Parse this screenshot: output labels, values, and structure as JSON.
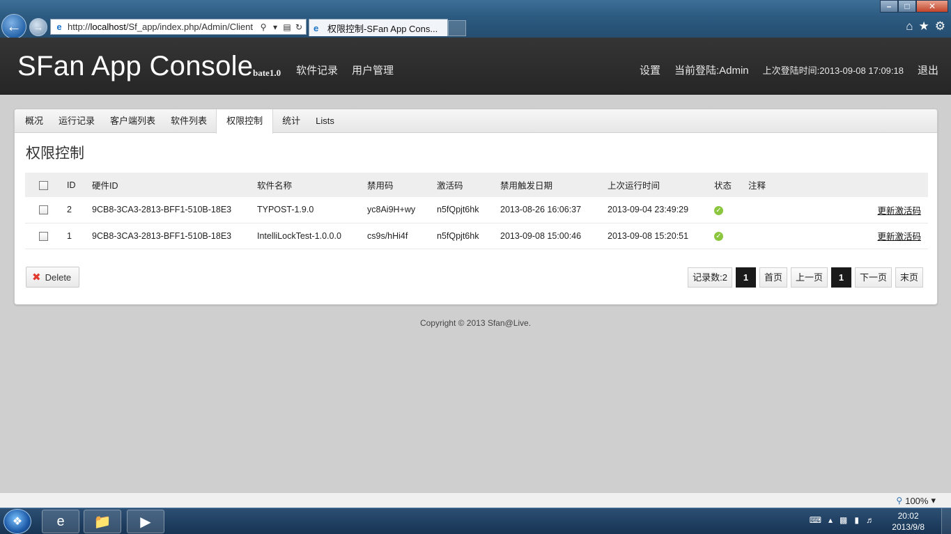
{
  "browser": {
    "url_prefix": "http://",
    "url_host": "localhost",
    "url_path": "/Sf_app/index.php/Admin/Client",
    "tab_title": "权限控制-SFan App Cons...",
    "zoom": "100%"
  },
  "header": {
    "brand": "SFan App Console",
    "version": "bate1.0",
    "nav": [
      "软件记录",
      "用户管理"
    ],
    "settings": "设置",
    "current_user": "当前登陆:Admin",
    "last_login": "上次登陆时间:2013-09-08 17:09:18",
    "logout": "退出"
  },
  "tabs": [
    {
      "label": "概况",
      "active": false
    },
    {
      "label": "运行记录",
      "active": false
    },
    {
      "label": "客户端列表",
      "active": false
    },
    {
      "label": "软件列表",
      "active": false
    },
    {
      "label": "权限控制",
      "active": true
    },
    {
      "label": "统计",
      "active": false
    },
    {
      "label": "Lists",
      "active": false
    }
  ],
  "page_title": "权限控制",
  "table": {
    "columns": [
      "ID",
      "硬件ID",
      "软件名称",
      "禁用码",
      "激活码",
      "禁用触发日期",
      "上次运行时间",
      "状态",
      "注释"
    ],
    "rows": [
      {
        "id": "2",
        "hwid": "9CB8-3CA3-2813-BFF1-510B-18E3",
        "software": "TYPOST-1.9.0",
        "ban_code": "yc8Ai9H+wy",
        "act_code": "n5fQpjt6hk",
        "ban_date": "2013-08-26 16:06:37",
        "last_run": "2013-09-04 23:49:29",
        "status": "ok",
        "note": "",
        "action": "更新激活码"
      },
      {
        "id": "1",
        "hwid": "9CB8-3CA3-2813-BFF1-510B-18E3",
        "software": "IntelliLockTest-1.0.0.0",
        "ban_code": "cs9s/hHi4f",
        "act_code": "n5fQpjt6hk",
        "ban_date": "2013-09-08 15:00:46",
        "last_run": "2013-09-08 15:20:51",
        "status": "ok",
        "note": "",
        "action": "更新激活码"
      }
    ]
  },
  "delete_label": "Delete",
  "pager": {
    "record_count": "记录数:2",
    "total_pages": "1",
    "first": "首页",
    "prev": "上一页",
    "current": "1",
    "next": "下一页",
    "last": "末页"
  },
  "footer": "Copyright © 2013 Sfan@Live.",
  "taskbar": {
    "time": "20:02",
    "date": "2013/9/8"
  },
  "colors": {
    "header_bg": "#2e2e2e",
    "page_bg": "#cfcfcf",
    "status_ok": "#8cc63f",
    "delete_icon": "#e03a2f",
    "pager_current": "#1a1a1a"
  }
}
